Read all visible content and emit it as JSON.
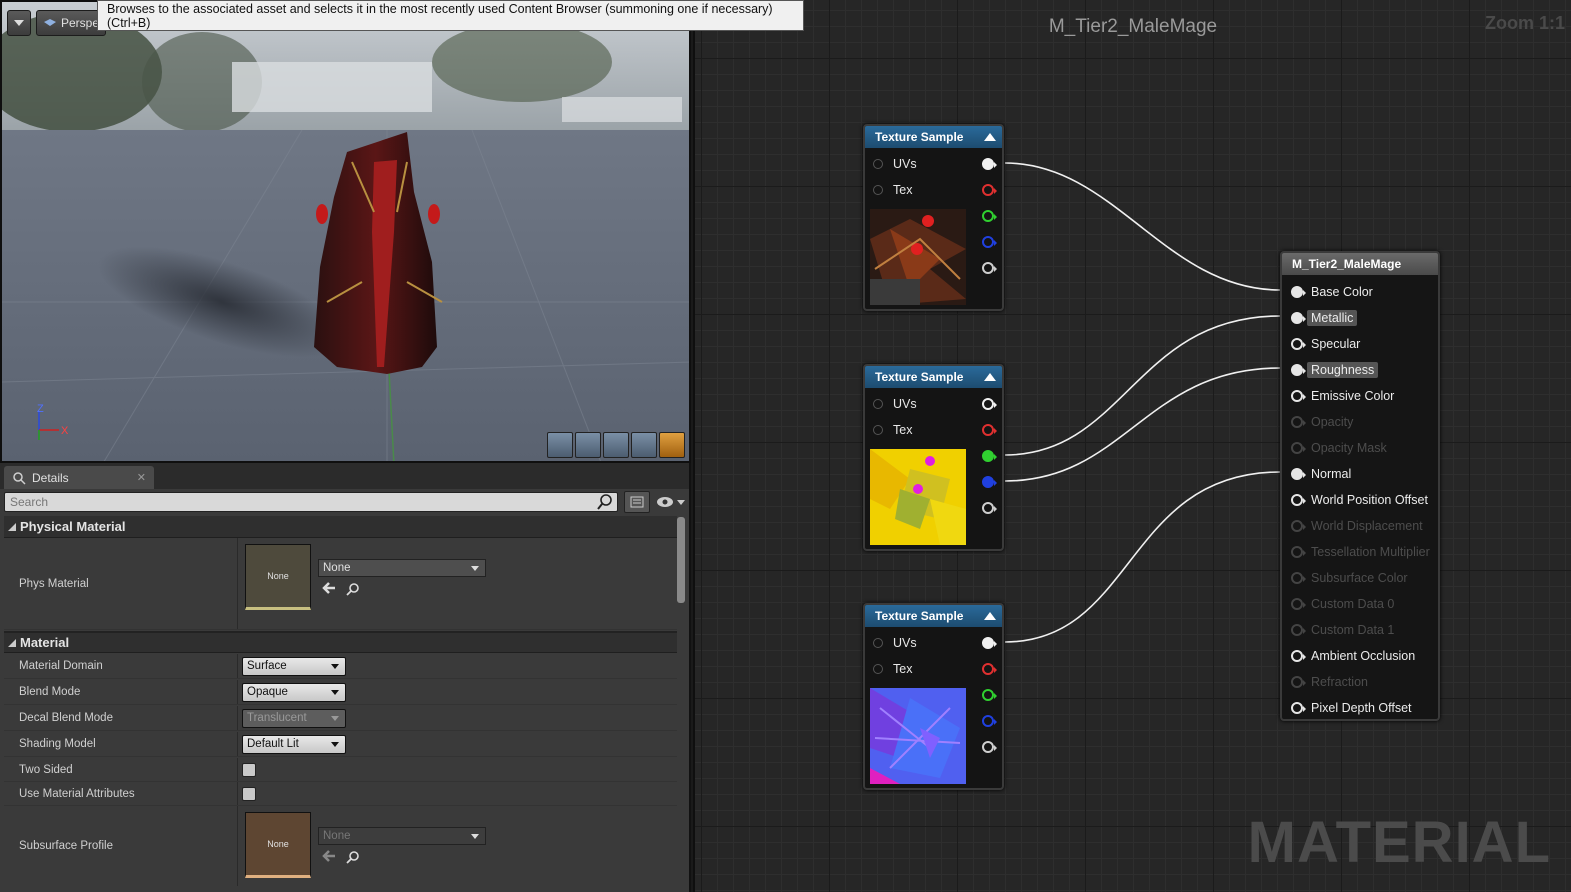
{
  "tooltip": "Browses to the associated asset and selects it in the most recently used Content Browser (summoning one if necessary) (Ctrl+B)",
  "viewport": {
    "perspective_label": "Perspe",
    "axis_x": "X",
    "axis_z": "Z"
  },
  "details": {
    "tab_label": "Details",
    "search_placeholder": "Search",
    "physical_material": {
      "header": "Physical Material",
      "phys_material_label": "Phys Material",
      "thumb_text": "None",
      "value": "None"
    },
    "material": {
      "header": "Material",
      "domain_label": "Material Domain",
      "domain_value": "Surface",
      "blend_label": "Blend Mode",
      "blend_value": "Opaque",
      "decal_label": "Decal Blend Mode",
      "decal_value": "Translucent",
      "shading_label": "Shading Model",
      "shading_value": "Default Lit",
      "two_sided_label": "Two Sided",
      "use_attr_label": "Use Material Attributes",
      "subsurface_label": "Subsurface Profile",
      "subsurface_thumb": "None",
      "subsurface_value": "None"
    }
  },
  "graph": {
    "title": "M_Tier2_MaleMage",
    "zoom": "Zoom 1:1",
    "watermark": "MATERIAL",
    "texture_nodes": [
      {
        "title": "Texture Sample",
        "uvs": "UVs",
        "tex": "Tex"
      },
      {
        "title": "Texture Sample",
        "uvs": "UVs",
        "tex": "Tex"
      },
      {
        "title": "Texture Sample",
        "uvs": "UVs",
        "tex": "Tex"
      }
    ],
    "result_node": {
      "title": "M_Tier2_MaleMage",
      "pins": [
        "Base Color",
        "Metallic",
        "Specular",
        "Roughness",
        "Emissive Color",
        "Opacity",
        "Opacity Mask",
        "Normal",
        "World Position Offset",
        "World Displacement",
        "Tessellation Multiplier",
        "Subsurface Color",
        "Custom Data 0",
        "Custom Data 1",
        "Ambient Occlusion",
        "Refraction",
        "Pixel Depth Offset"
      ]
    }
  },
  "colors": {
    "node_header": "#2a6a9a",
    "pin_red": "#e03030",
    "pin_green": "#30d030",
    "pin_blue": "#2040e0"
  }
}
